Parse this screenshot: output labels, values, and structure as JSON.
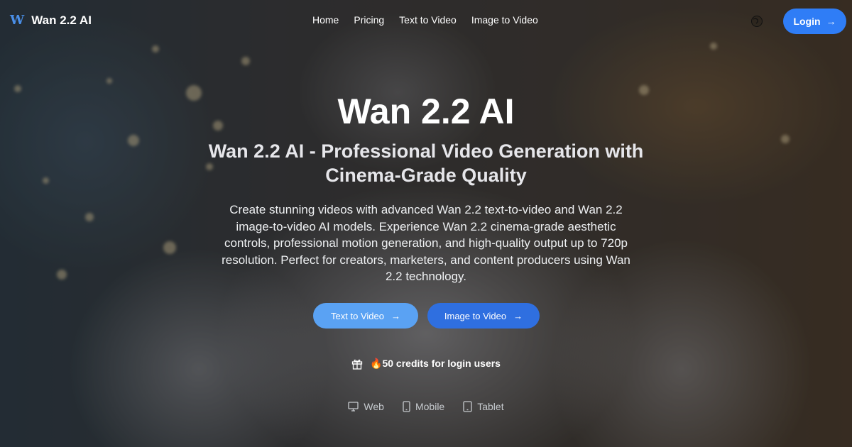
{
  "brand": {
    "logo_letter": "W",
    "name": "Wan 2.2 AI"
  },
  "nav": {
    "items": [
      {
        "label": "Home"
      },
      {
        "label": "Pricing"
      },
      {
        "label": "Text to Video"
      },
      {
        "label": "Image to Video"
      }
    ]
  },
  "header": {
    "theme_icon": "globe-icon",
    "login_label": "Login",
    "login_arrow": "→"
  },
  "hero": {
    "title": "Wan 2.2 AI",
    "subtitle": "Wan 2.2 AI - Professional Video Generation with Cinema-Grade Quality",
    "description": "Create stunning videos with advanced Wan 2.2 text-to-video and Wan 2.2 image-to-video AI models. Experience Wan 2.2 cinema-grade aesthetic controls, professional motion generation, and high-quality output up to 720p resolution. Perfect for creators, marketers, and content producers using Wan 2.2 technology.",
    "buttons": [
      {
        "label": "Text to Video",
        "arrow": "→"
      },
      {
        "label": "Image to Video",
        "arrow": "→"
      }
    ]
  },
  "credits": {
    "icon": "gift-icon",
    "text": "🔥50 credits for login users"
  },
  "platforms": [
    {
      "icon": "monitor-icon",
      "label": "Web"
    },
    {
      "icon": "phone-icon",
      "label": "Mobile"
    },
    {
      "icon": "tablet-icon",
      "label": "Tablet"
    }
  ],
  "colors": {
    "accent": "#2f7df6",
    "button_light": "#5aa2f3",
    "button_dark": "#2f6fe0",
    "logo": "#4a8fe8"
  }
}
